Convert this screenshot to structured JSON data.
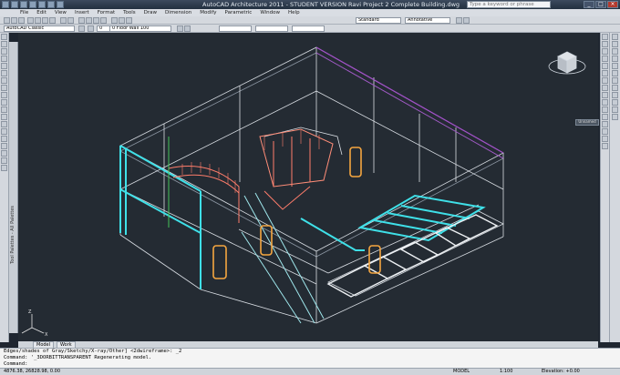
{
  "titlebar": {
    "title": "AutoCAD Architecture 2011 - STUDENT VERSION    Ravi Project 2 Complete Building.dwg",
    "search_placeholder": "Type a keyword or phrase"
  },
  "menu": {
    "items": [
      "File",
      "Edit",
      "View",
      "Insert",
      "Format",
      "Tools",
      "Draw",
      "Dimension",
      "Modify",
      "Parametric",
      "Window",
      "Help"
    ]
  },
  "toolbars": {
    "workspace": "AutoCAD Classic",
    "style": "Standard",
    "wall_style": "0 Floor Wall 100",
    "annotative": "Annotative",
    "layer": "0"
  },
  "palette": {
    "label": "Tool Palettes - All Palettes"
  },
  "viewcube": {
    "label": "Unnamed"
  },
  "layout_tabs": [
    "Model",
    "Work"
  ],
  "command_history": [
    "Edges/shades of Gray/Sketchy/X-ray/Other] <2dwireframe>: _2",
    "Command: '_3DORBITTRANSPARENT Regenerating model."
  ],
  "command_prompt": "Command:",
  "status": {
    "coordinates": "4876.38, 26828.98, 0.00",
    "model_label": "MODEL",
    "scale": "1:100",
    "elevation": "Elevation: +0.00"
  },
  "colors": {
    "viewport_bg": "#242b33",
    "wall_lines": "#d8dde3",
    "stair_rail": "#ff7d6b",
    "cyan_glass": "#3fe0e8",
    "door_frame": "#f5a640",
    "green_line": "#45c35a"
  }
}
